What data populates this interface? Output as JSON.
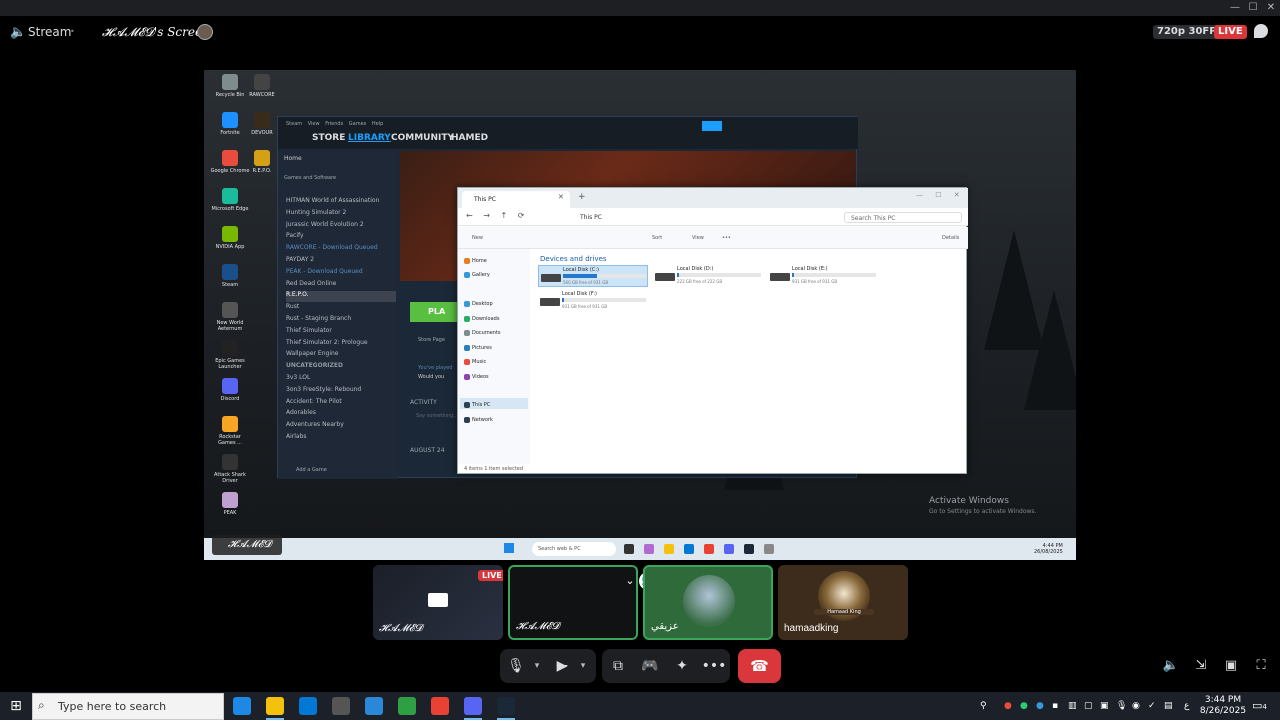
{
  "stream": {
    "label": "Stream",
    "title": "𝓗𝓐𝓜𝓔𝓓's Screen",
    "quality": "720p 30FPS",
    "live": "LIVE"
  },
  "remote": {
    "desktop_icons": [
      {
        "label": "Recycle Bin",
        "color": "#7f8c8d"
      },
      {
        "label": "RAWCORE",
        "color": "#444"
      },
      {
        "label": "Fortnite",
        "color": "#1e90ff"
      },
      {
        "label": "DEVOUR",
        "color": "#3a2a1a"
      },
      {
        "label": "Google Chrome",
        "color": "#e74c3c"
      },
      {
        "label": "R.E.P.O.",
        "color": "#d4a017"
      },
      {
        "label": "Microsoft Edge",
        "color": "#1abc9c"
      },
      {
        "label": "NVIDIA App",
        "color": "#76b900"
      },
      {
        "label": "Steam",
        "color": "#1b4f8a"
      },
      {
        "label": "New World Aeternum",
        "color": "#555"
      },
      {
        "label": "Epic Games Launcher",
        "color": "#222"
      },
      {
        "label": "Discord",
        "color": "#5865f2"
      },
      {
        "label": "Rockstar Games ...",
        "color": "#f5a623"
      },
      {
        "label": "Attack Shark Driver",
        "color": "#333"
      },
      {
        "label": "PEAK",
        "color": "#c0a0d0"
      }
    ],
    "steam": {
      "menu": [
        "Steam",
        "View",
        "Friends",
        "Games",
        "Help"
      ],
      "nav": [
        "STORE",
        "LIBRARY",
        "COMMUNITY",
        "HAMED"
      ],
      "home": "Home",
      "filter": "Games and Software",
      "games": [
        {
          "name": "HITMAN World of Assassination",
          "state": ""
        },
        {
          "name": "Hunting Simulator 2",
          "state": ""
        },
        {
          "name": "Jurassic World Evolution 2",
          "state": ""
        },
        {
          "name": "Pacify",
          "state": ""
        },
        {
          "name": "RAWCORE - Download Queued",
          "state": "q"
        },
        {
          "name": "PAYDAY 2",
          "state": ""
        },
        {
          "name": "PEAK - Download Queued",
          "state": "q"
        },
        {
          "name": "Red Dead Online",
          "state": ""
        },
        {
          "name": "R.E.P.O.",
          "state": "sel"
        },
        {
          "name": "Rust",
          "state": ""
        },
        {
          "name": "Rust - Staging Branch",
          "state": ""
        },
        {
          "name": "Thief Simulator",
          "state": ""
        },
        {
          "name": "Thief Simulator 2: Prologue",
          "state": ""
        },
        {
          "name": "Wallpaper Engine",
          "state": ""
        },
        {
          "name": "UNCATEGORIZED",
          "state": "hdr"
        },
        {
          "name": "3v3 LOL",
          "state": ""
        },
        {
          "name": "3on3 FreeStyle: Rebound",
          "state": ""
        },
        {
          "name": "Accident: The Pilot",
          "state": ""
        },
        {
          "name": "Adorables",
          "state": ""
        },
        {
          "name": "Adventures Nearby",
          "state": ""
        },
        {
          "name": "Airlabs",
          "state": ""
        }
      ],
      "play": "PLA",
      "store_page": "Store Page",
      "activity": "ACTIVITY",
      "activity_hint": "Say something...",
      "date": "AUGUST 24",
      "youve": "You've played",
      "would": "Would you",
      "add_game": "Add a Game"
    },
    "explorer": {
      "tab": "This PC",
      "path": "This PC",
      "search": "Search This PC",
      "toolbar": [
        "New",
        "Sort",
        "View",
        "•••",
        "Details"
      ],
      "nav": [
        {
          "label": "Home",
          "color": "#e67e22"
        },
        {
          "label": "Gallery",
          "color": "#3498db"
        },
        {
          "label": "Desktop",
          "color": "#3498db"
        },
        {
          "label": "Downloads",
          "color": "#27ae60"
        },
        {
          "label": "Documents",
          "color": "#7f8c8d"
        },
        {
          "label": "Pictures",
          "color": "#2980b9"
        },
        {
          "label": "Music",
          "color": "#e74c3c"
        },
        {
          "label": "Videos",
          "color": "#8e44ad"
        },
        {
          "label": "This PC",
          "color": "#2c3e50"
        },
        {
          "label": "Network",
          "color": "#2c3e50"
        }
      ],
      "section": "Devices and drives",
      "drives": [
        {
          "name": "Local Disk (C:)",
          "free": "560 GB free of 931 GB",
          "used": 0.4
        },
        {
          "name": "Local Disk (D:)",
          "free": "222 GB free of 222 GB",
          "used": 0.02
        },
        {
          "name": "Local Disk (E:)",
          "free": "931 GB free of 931 GB",
          "used": 0.02
        },
        {
          "name": "Local Disk (F:)",
          "free": "931 GB free of 931 GB",
          "used": 0.02
        }
      ],
      "status": "4 items    1 item selected"
    },
    "activate_title": "Activate Windows",
    "activate_sub": "Go to Settings to activate Windows.",
    "taskbar_search": "Search web & PC",
    "time": "4:44 PM",
    "date": "26/08/2025",
    "watermark": "𝓗𝓐𝓜𝓔𝓓"
  },
  "tiles": [
    {
      "name": "𝓗𝓐𝓜𝓔𝓓",
      "live": "LIVE"
    },
    {
      "name": "𝓗𝓐𝓜𝓔𝓓"
    },
    {
      "name": "عزيقي"
    },
    {
      "name": "hamaadking",
      "badge": "Hamaad King"
    }
  ],
  "taskbar": {
    "search": "Type here to search",
    "apps": [
      {
        "name": "edge",
        "color": "#1e88e5"
      },
      {
        "name": "explorer",
        "color": "#f4c20d"
      },
      {
        "name": "mail",
        "color": "#0078d4"
      },
      {
        "name": "store",
        "color": "#555"
      },
      {
        "name": "app-blue",
        "color": "#2b88d8"
      },
      {
        "name": "app-green",
        "color": "#2ea043"
      },
      {
        "name": "chrome",
        "color": "#e94235"
      },
      {
        "name": "discord",
        "color": "#5865f2"
      },
      {
        "name": "steam",
        "color": "#1b2838"
      }
    ],
    "lang": "ع",
    "time": "3:44 PM",
    "date": "8/26/2025",
    "notifications": "4"
  }
}
